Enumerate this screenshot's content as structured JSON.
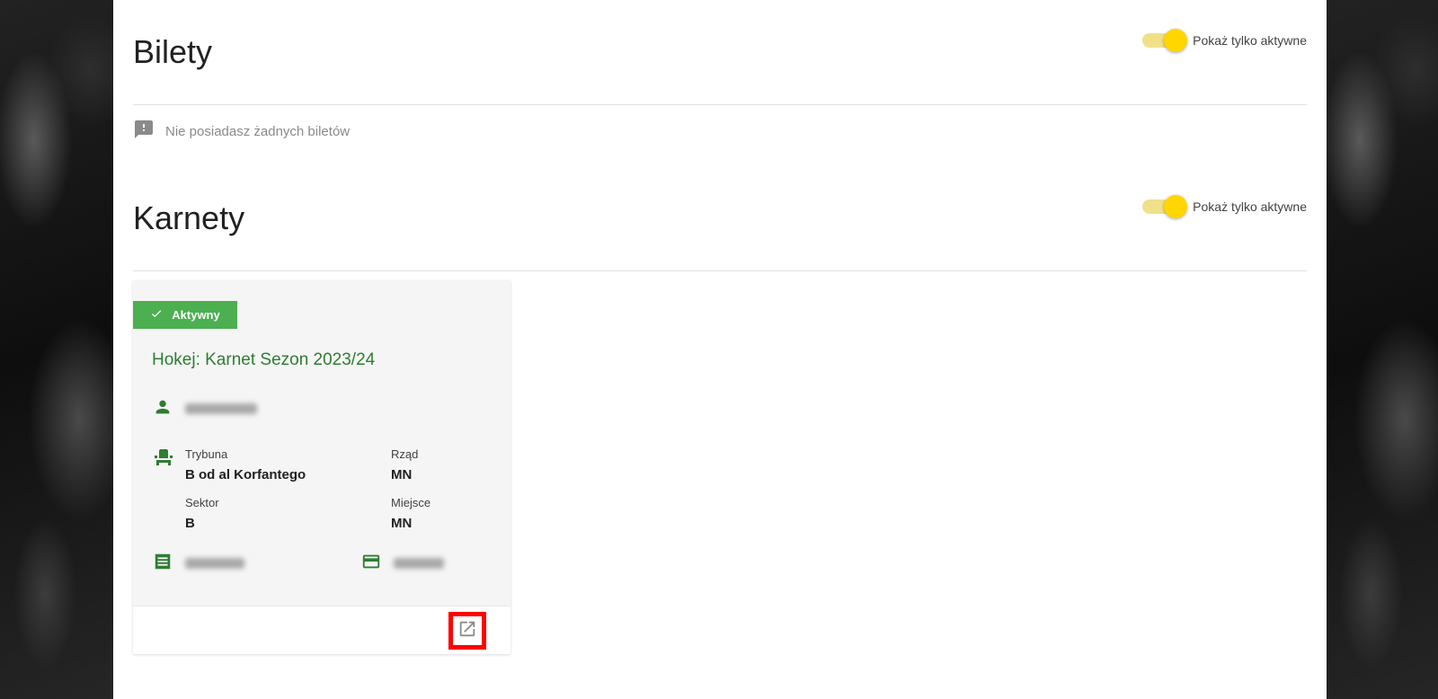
{
  "bilety": {
    "title": "Bilety",
    "toggle_label": "Pokaż tylko aktywne",
    "empty_message": "Nie posiadasz żadnych biletów"
  },
  "karnety": {
    "title": "Karnety",
    "toggle_label": "Pokaż tylko aktywne",
    "card": {
      "status_badge": "Aktywny",
      "title": "Hokej: Karnet Sezon 2023/24",
      "trybuna_label": "Trybuna",
      "trybuna_value": "B od al Korfantego",
      "rzad_label": "Rząd",
      "rzad_value": "MN",
      "sektor_label": "Sektor",
      "sektor_value": "B",
      "miejsce_label": "Miejsce",
      "miejsce_value": "MN"
    }
  },
  "colors": {
    "accent_green": "#4caf50",
    "title_green": "#2e7d32",
    "toggle_yellow": "#ffd600",
    "highlight_red": "#ff0000"
  },
  "icons": {
    "holder": "person-icon",
    "seat": "seat-icon",
    "order": "receipt-icon",
    "payment": "credit-card-icon",
    "open": "open-in-new-icon",
    "empty": "feedback-icon",
    "badge": "check-icon"
  }
}
